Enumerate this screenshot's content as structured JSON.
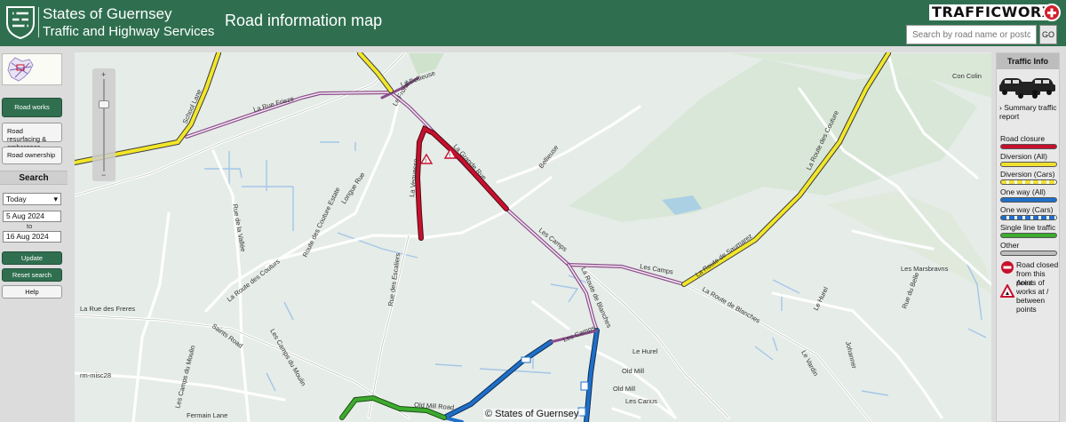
{
  "header": {
    "org_line1": "States of Guernsey",
    "org_line2": "Traffic and Highway Services",
    "app_title": "Road information map",
    "brand": "TRAFFICWORX",
    "search_placeholder": "Search by road name or postcode",
    "search_button": "GO"
  },
  "sidebar": {
    "road_works": "Road works",
    "resurfacing": "Road resurfacing & embargoes",
    "ownership": "Road ownership",
    "search_heading": "Search",
    "period_selected": "Today",
    "date_from": "5 Aug 2024",
    "to_label": "to",
    "date_to": "16 Aug 2024",
    "update": "Update",
    "reset": "Reset search",
    "help": "Help"
  },
  "map": {
    "copyright": "© States of Guernsey",
    "road_labels": [
      "La Rue Frieze",
      "Les Camps",
      "La Grande Rue",
      "Les Camps",
      "Les Camps",
      "La Route de Saumarez",
      "La Route des Couture",
      "La Route des Couturs",
      "Route des Couture Estate",
      "Longue Rue",
      "Rue de la Vallée",
      "Rue des Escaliers",
      "La Rue des Freres",
      "Saints Road",
      "Les Camps du Moulin",
      "Les Camps du Moulin",
      "Old Mill Road",
      "La Route de Blanches",
      "La Route de Blanches",
      "Le Vardin",
      "Les Marsbravns",
      "Le Hurel",
      "Le Hurel",
      "Old Mill",
      "Old Mill",
      "Les Canus",
      "School Lane",
      "La Vequesse",
      "Bellieuse",
      "La Bellieuse",
      "Le Frorail",
      "Rue du Belle",
      "Fermain Lane",
      "Con Colin",
      "Johanner",
      "rm-misc28"
    ]
  },
  "info": {
    "title": "Traffic Info",
    "summary": "Summary traffic report",
    "legend": [
      {
        "label": "Road closure",
        "color": "#c8102e",
        "style": "solid"
      },
      {
        "label": "Diversion (All)",
        "color": "#f0e130",
        "style": "solid"
      },
      {
        "label": "Diversion (Cars)",
        "color": "#f0e130",
        "style": "dashed"
      },
      {
        "label": "One way (All)",
        "color": "#1f6fc8",
        "style": "solid"
      },
      {
        "label": "One way (Cars)",
        "color": "#1f6fc8",
        "style": "dashed"
      },
      {
        "label": "Single line traffic",
        "color": "#3cab2e",
        "style": "solid"
      },
      {
        "label": "Other",
        "color": "#bdbdbd",
        "style": "solid"
      }
    ],
    "icon_legend": [
      {
        "label": "Road closed from this point",
        "icon": "no-entry-icon"
      },
      {
        "label": "Areas of works at / between points",
        "icon": "roadworks-warning-icon"
      }
    ]
  }
}
